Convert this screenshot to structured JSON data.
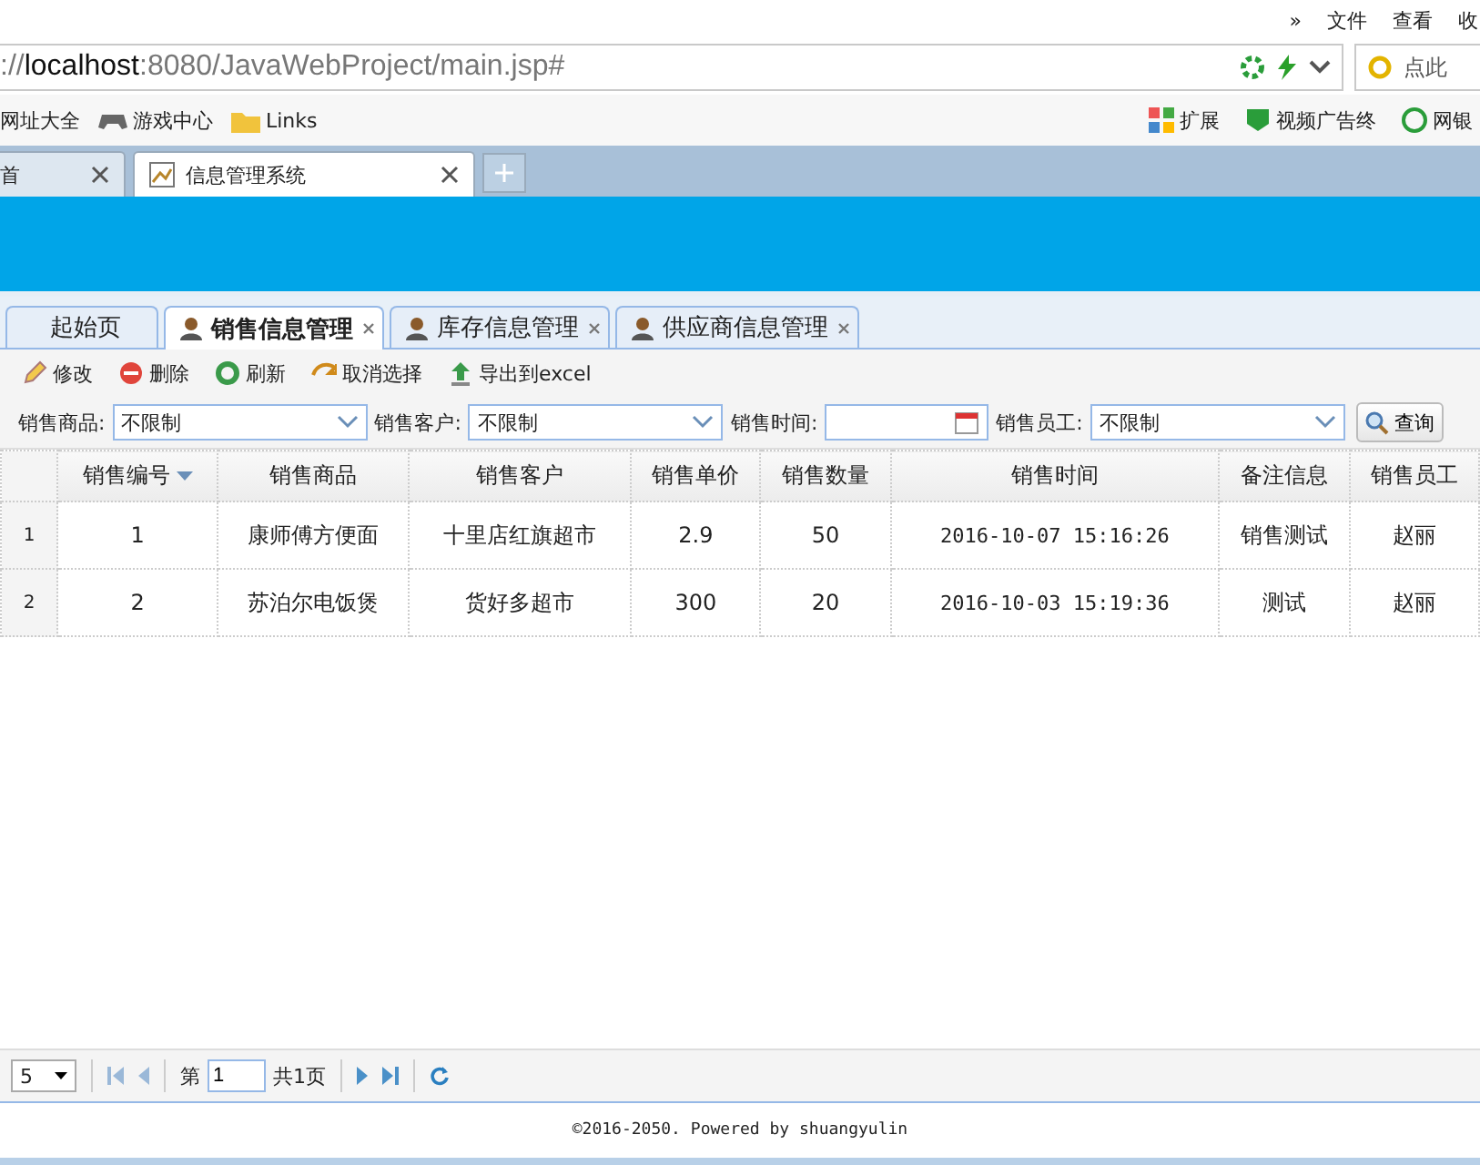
{
  "browser": {
    "menu": [
      "»",
      "文件",
      "查看",
      "收"
    ],
    "address": {
      "prefix": "://",
      "host": "localhost",
      "rest": ":8080/JavaWebProject/main.jsp#"
    },
    "search_placeholder": "点此",
    "bookmarks": [
      {
        "label": "网址大全",
        "kind": "text"
      },
      {
        "label": "游戏中心",
        "kind": "game"
      },
      {
        "label": "Links",
        "kind": "folder"
      }
    ],
    "extensions": [
      "扩展",
      "视频广告终",
      "网银"
    ],
    "tabs": [
      {
        "title": "首",
        "selected": false
      },
      {
        "title": "信息管理系统",
        "selected": true
      }
    ]
  },
  "app_tabs": [
    {
      "label": "起始页",
      "selected": false,
      "closable": false
    },
    {
      "label": "销售信息管理",
      "selected": true,
      "closable": true
    },
    {
      "label": "库存信息管理",
      "selected": false,
      "closable": true
    },
    {
      "label": "供应商信息管理",
      "selected": false,
      "closable": true
    }
  ],
  "toolbar": [
    {
      "label": "修改",
      "kind": "edit"
    },
    {
      "label": "删除",
      "kind": "delete"
    },
    {
      "label": "刷新",
      "kind": "refresh"
    },
    {
      "label": "取消选择",
      "kind": "undo"
    },
    {
      "label": "导出到excel",
      "kind": "export"
    }
  ],
  "filters": [
    {
      "label": "销售商品:",
      "kind": "select",
      "value": "不限制"
    },
    {
      "label": "销售客户:",
      "kind": "select",
      "value": "不限制"
    },
    {
      "label": "销售时间:",
      "kind": "date"
    },
    {
      "label": "销售员工:",
      "kind": "select",
      "value": "不限制"
    }
  ],
  "search_button": "查询",
  "table": {
    "columns": [
      {
        "label": "销售编号",
        "sort_desc": true
      },
      {
        "label": "销售商品",
        "sort_desc": false
      },
      {
        "label": "销售客户",
        "sort_desc": false
      },
      {
        "label": "销售单价",
        "sort_desc": false
      },
      {
        "label": "销售数量",
        "sort_desc": false
      },
      {
        "label": "销售时间",
        "sort_desc": false
      },
      {
        "label": "备注信息",
        "sort_desc": false
      },
      {
        "label": "销售员工",
        "sort_desc": false
      }
    ],
    "rows": [
      {
        "number": "1",
        "cells": [
          "1",
          "康师傅方便面",
          "十里店红旗超市",
          "2.9",
          "50",
          "2016-10-07 15:16:26",
          "销售测试",
          "赵丽"
        ]
      },
      {
        "number": "2",
        "cells": [
          "2",
          "苏泊尔电饭煲",
          "货好多超市",
          "300",
          "20",
          "2016-10-03 15:19:36",
          "测试",
          "赵丽"
        ]
      }
    ]
  },
  "pager": {
    "page_size": "5",
    "page_prefix": "第",
    "page": "1",
    "page_total": "共1页"
  },
  "footer": "©2016-2050. Powered by shuangyulin"
}
